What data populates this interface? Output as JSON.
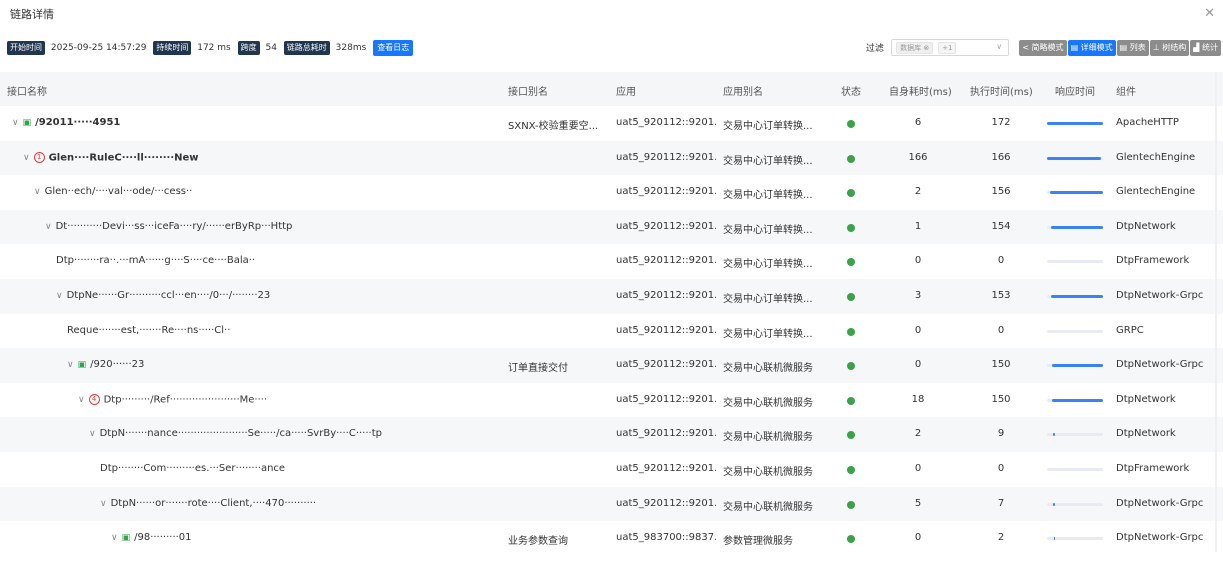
{
  "window": {
    "title": "链路详情",
    "close_icon": "close-icon"
  },
  "toolbar": {
    "start_badge": "开始时间",
    "start_value": "2025-09-25 14:57:29",
    "duration_badge": "持续时间",
    "duration_value": "172 ms",
    "span_badge": "跨度",
    "span_value": "54",
    "total_badge": "链路总耗时",
    "total_value": "328ms",
    "log_button": "查看日志",
    "filter_label": "过滤",
    "filter_tag": "数据库 ⊗",
    "filter_more": "+1",
    "modes": [
      "< 简略模式",
      "▤ 详细模式",
      "▤ 列表",
      "⊥ 树结构",
      "▟ 统计"
    ],
    "active_mode": 1
  },
  "columns": [
    "接口名称",
    "接口别名",
    "应用",
    "应用别名",
    "状态",
    "自身耗时(ms)",
    "执行时间(ms)",
    "响应时间",
    "组件"
  ],
  "rows": [
    {
      "indent": 0,
      "caret": "∨",
      "icon": "green",
      "name": "/92011·····4951",
      "bold": true,
      "alias": "SXNX-校验重要空...",
      "app": "uat5_920112::9201...",
      "app_alias": "交易中心订单转换...",
      "self": "6",
      "exec": "172",
      "resp": {
        "start": 0.0,
        "width": 1.0
      },
      "component": "ApacheHTTP"
    },
    {
      "indent": 1,
      "caret": "∨",
      "icon": "red",
      "icon_text": "1",
      "name": "Glen····RuleC····ll········New",
      "bold": true,
      "alias": "",
      "app": "uat5_920112::9201...",
      "app_alias": "交易中心订单转换...",
      "self": "166",
      "exec": "166",
      "resp": {
        "start": 0.0,
        "width": 0.97
      },
      "component": "GlentechEngine"
    },
    {
      "indent": 2,
      "caret": "∨",
      "icon": "",
      "name": "Glen··ech/····val···ode/···cess··",
      "bold": false,
      "alias": "",
      "app": "uat5_920112::9201...",
      "app_alias": "交易中心订单转换...",
      "self": "2",
      "exec": "156",
      "resp": {
        "start": 0.06,
        "width": 0.94
      },
      "component": "GlentechEngine"
    },
    {
      "indent": 3,
      "caret": "∨",
      "icon": "",
      "name": "Dt···········Devi···ss···iceFa····ry/······erByRp···Http",
      "bold": false,
      "alias": "",
      "app": "uat5_920112::9201...",
      "app_alias": "交易中心订单转换...",
      "self": "1",
      "exec": "154",
      "resp": {
        "start": 0.07,
        "width": 0.93
      },
      "component": "DtpNetwork"
    },
    {
      "indent": 4,
      "caret": "",
      "icon": "",
      "name": "Dtp········ra··.···mA······g····S····ce····Bala··",
      "bold": false,
      "alias": "",
      "app": "uat5_920112::9201...",
      "app_alias": "交易中心订单转换...",
      "self": "0",
      "exec": "0",
      "resp": {
        "start": 0.0,
        "width": 0.0
      },
      "component": "DtpFramework"
    },
    {
      "indent": 4,
      "caret": "∨",
      "icon": "",
      "name": "DtpNe······Gr··········ccl···en····/0···/········23",
      "bold": false,
      "alias": "",
      "app": "uat5_920112::9201...",
      "app_alias": "交易中心订单转换...",
      "self": "3",
      "exec": "153",
      "resp": {
        "start": 0.08,
        "width": 0.92
      },
      "component": "DtpNetwork-Grpc"
    },
    {
      "indent": 5,
      "caret": "",
      "icon": "",
      "name": "Reque·······est,·······Re····ns·····Cl··",
      "bold": false,
      "alias": "",
      "app": "uat5_920112::9201...",
      "app_alias": "交易中心订单转换...",
      "self": "0",
      "exec": "0",
      "resp": {
        "start": 0.0,
        "width": 0.0
      },
      "component": "GRPC"
    },
    {
      "indent": 5,
      "caret": "∨",
      "icon": "green",
      "name": "/920······23",
      "bold": false,
      "alias": "订单直接交付",
      "app": "uat5_920112::9201...",
      "app_alias": "交易中心联机微服务",
      "self": "0",
      "exec": "150",
      "resp": {
        "start": 0.09,
        "width": 0.91
      },
      "component": "DtpNetwork-Grpc"
    },
    {
      "indent": 6,
      "caret": "∨",
      "icon": "red",
      "icon_text": "4",
      "name": "Dtp·········/Ref······················Me····",
      "bold": false,
      "alias": "",
      "app": "uat5_920112::9201...",
      "app_alias": "交易中心联机微服务",
      "self": "18",
      "exec": "150",
      "resp": {
        "start": 0.09,
        "width": 0.91
      },
      "component": "DtpNetwork"
    },
    {
      "indent": 7,
      "caret": "∨",
      "icon": "",
      "name": "DtpN·······nance······················Se·····/ca·····SvrBy····C·····tp",
      "bold": false,
      "alias": "",
      "app": "uat5_920112::9201...",
      "app_alias": "交易中心联机微服务",
      "self": "2",
      "exec": "9",
      "resp": {
        "start": 0.1,
        "width": 0.05
      },
      "component": "DtpNetwork"
    },
    {
      "indent": 8,
      "caret": "",
      "icon": "",
      "name": "Dtp········Com·········es.···Ser········ance",
      "bold": false,
      "alias": "",
      "app": "uat5_920112::9201...",
      "app_alias": "交易中心联机微服务",
      "self": "0",
      "exec": "0",
      "resp": {
        "start": 0.0,
        "width": 0.0
      },
      "component": "DtpFramework"
    },
    {
      "indent": 8,
      "caret": "∨",
      "icon": "",
      "name": "DtpN······or·······rote····Client,····470··········",
      "bold": false,
      "alias": "",
      "app": "uat5_920112::9201...",
      "app_alias": "交易中心联机微服务",
      "self": "5",
      "exec": "7",
      "resp": {
        "start": 0.1,
        "width": 0.04
      },
      "component": "DtpNetwork-Grpc"
    },
    {
      "indent": 9,
      "caret": "∨",
      "icon": "green",
      "name": "/98·········01",
      "bold": false,
      "alias": "业务参数查询",
      "app": "uat5_983700::9837...",
      "app_alias": "参数管理微服务",
      "self": "0",
      "exec": "2",
      "resp": {
        "start": 0.12,
        "width": 0.02
      },
      "component": "DtpNetwork-Grpc"
    }
  ],
  "colors": {
    "accent": "#1677ff",
    "badge": "#1f3550",
    "status_ok": "#3aa346",
    "bar": "#3b82f6",
    "error": "#e23b3b"
  }
}
